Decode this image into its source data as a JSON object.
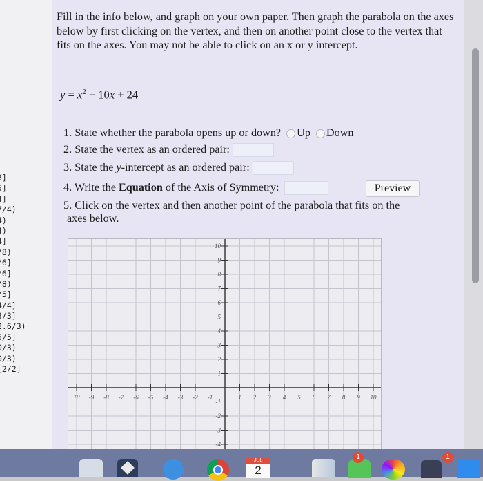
{
  "sidebar": {
    "scores": [
      "3]",
      "5]",
      "4]",
      "7/4)",
      "4)",
      "4)",
      "4]",
      "/8)",
      "/6]",
      "/6]",
      "/8)",
      "/5]",
      "4/4]",
      "3/3]",
      "2.6/3)",
      "5/5]",
      "0/3)",
      "0/3)",
      "[2/2]"
    ]
  },
  "instructions": "Fill in the info below, and graph on your own paper. Then graph the parabola on the axes below by first clicking on the vertex, and then on another point close to the vertex that fits on the axes. You may not be able to click on an x or y intercept.",
  "equation": {
    "lhs": "y",
    "eq": " = ",
    "x": "x",
    "exp": "2",
    "rest_a": " + 10",
    "x2": "x",
    "rest_b": " + 24"
  },
  "questions": {
    "q1": "1. State whether the parabola opens up or down?",
    "q1_up": "Up",
    "q1_down": "Down",
    "q2": "2. State the vertex as an ordered pair:",
    "q3_pre": "3. State the ",
    "q3_var": "y",
    "q3_post": "-intercept as an ordered pair:",
    "q4_pre": "4. Write the ",
    "q4_bold": "Equation",
    "q4_post": " of the Axis of Symmetry:",
    "q5_line1": "5. Click on the vertex and then another point of the parabola that fits on the",
    "q5_line2": "axes below."
  },
  "preview_label": "Preview",
  "graph": {
    "x_min": -10,
    "x_max": 10,
    "y_min": -4,
    "y_max": 10,
    "x_labels": [
      "10",
      "-9",
      "-8",
      "-7",
      "-6",
      "-5",
      "-4",
      "-3",
      "-2",
      "-1",
      "1",
      "2",
      "3",
      "4",
      "5",
      "6",
      "7",
      "8",
      "9",
      "10"
    ],
    "y_labels": [
      "10",
      "9",
      "8",
      "7",
      "6",
      "5",
      "4",
      "3",
      "2",
      "1",
      "-1",
      "-2",
      "-3",
      "-4"
    ],
    "grid_color": "#c4c4cc",
    "axis_color": "#333333"
  },
  "taskbar": {
    "calendar_month": "JUL",
    "calendar_day": "2",
    "badge_a": "1",
    "badge_b": "1"
  },
  "colors": {
    "panel_bg": "#e7e4f4",
    "answer_box": "#edf0f8",
    "taskbar": "#6f7aa1"
  }
}
